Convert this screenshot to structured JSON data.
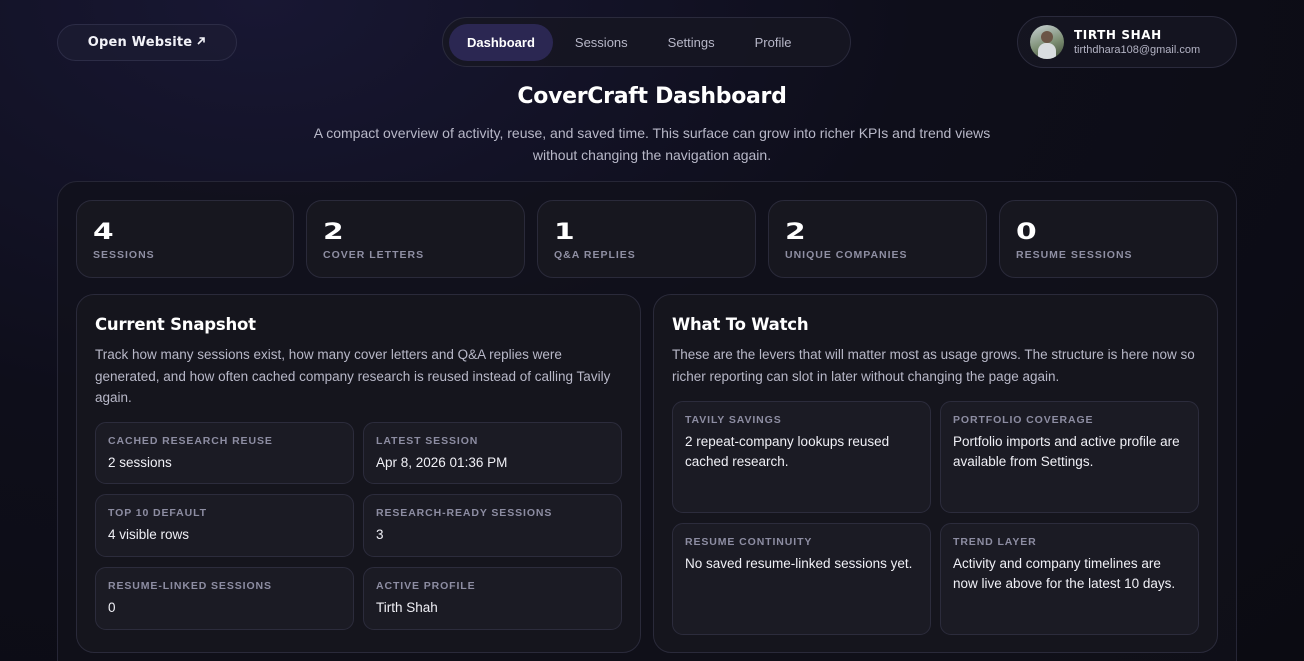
{
  "header": {
    "open_website": "Open Website",
    "open_website_icon": "arrow-up-right-icon",
    "nav": [
      "Dashboard",
      "Sessions",
      "Settings",
      "Profile"
    ],
    "active_nav": "Dashboard",
    "user": {
      "name": "TIRTH SHAH",
      "email": "tirthdhara108@gmail.com"
    }
  },
  "page": {
    "title": "CoverCraft Dashboard",
    "subtitle": "A compact overview of activity, reuse, and saved time. This surface can grow into richer KPIs and trend views without changing the navigation again."
  },
  "kpis": [
    {
      "value": "4",
      "label": "SESSIONS"
    },
    {
      "value": "2",
      "label": "COVER LETTERS"
    },
    {
      "value": "1",
      "label": "Q&A REPLIES"
    },
    {
      "value": "2",
      "label": "UNIQUE COMPANIES"
    },
    {
      "value": "0",
      "label": "RESUME SESSIONS"
    }
  ],
  "snapshot": {
    "title": "Current Snapshot",
    "description": "Track how many sessions exist, how many cover letters and Q&A replies were generated, and how often cached company research is reused instead of calling Tavily again.",
    "tiles": [
      {
        "label": "CACHED RESEARCH REUSE",
        "value": "2 sessions"
      },
      {
        "label": "LATEST SESSION",
        "value": "Apr 8, 2026 01:36 PM"
      },
      {
        "label": "TOP 10 DEFAULT",
        "value": "4 visible rows"
      },
      {
        "label": "RESEARCH-READY SESSIONS",
        "value": "3"
      },
      {
        "label": "RESUME-LINKED SESSIONS",
        "value": "0"
      },
      {
        "label": "ACTIVE PROFILE",
        "value": "Tirth Shah"
      }
    ]
  },
  "watch": {
    "title": "What To Watch",
    "description": "These are the levers that will matter most as usage grows. The structure is here now so richer reporting can slot in later without changing the page again.",
    "tiles": [
      {
        "label": "TAVILY SAVINGS",
        "value": "2 repeat-company lookups reused cached research."
      },
      {
        "label": "PORTFOLIO COVERAGE",
        "value": "Portfolio imports and active profile are available from Settings."
      },
      {
        "label": "RESUME CONTINUITY",
        "value": "No saved resume-linked sessions yet."
      },
      {
        "label": "TREND LAYER",
        "value": "Activity and company timelines are now live above for the latest 10 days."
      }
    ]
  }
}
